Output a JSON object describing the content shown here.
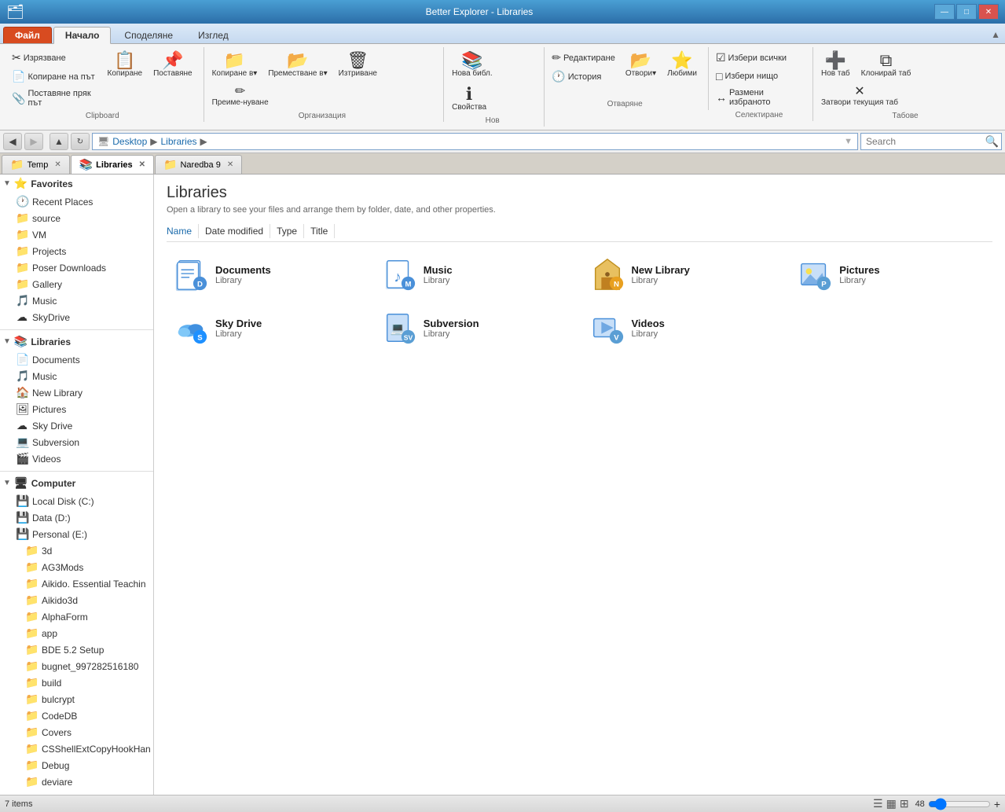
{
  "window": {
    "title": "Better Explorer - Libraries",
    "controls": [
      "—",
      "□",
      "✕"
    ]
  },
  "ribbon": {
    "tabs": [
      "Файл",
      "Начало",
      "Споделяне",
      "Изглед"
    ],
    "active_tab": "Начало",
    "groups": [
      {
        "label": "Clipboard",
        "buttons": [
          {
            "id": "copy",
            "label": "Копиране",
            "icon": "📋"
          },
          {
            "id": "paste",
            "label": "Поставяне",
            "icon": "📌"
          }
        ],
        "small_buttons": [
          {
            "label": "Изрязване",
            "icon": "✂"
          },
          {
            "label": "Копиране на път",
            "icon": "📄"
          },
          {
            "label": "Поставяне пряк път",
            "icon": "📎"
          }
        ]
      },
      {
        "label": "Организация",
        "buttons": [
          {
            "id": "copy-to",
            "label": "Копиране в▾",
            "icon": "📁"
          },
          {
            "id": "move-to",
            "label": "Преместване в▾",
            "icon": "📂"
          },
          {
            "id": "delete",
            "label": "Изтриване",
            "icon": "🗑"
          },
          {
            "id": "rename",
            "label": "Преиме-нуване",
            "icon": "✏"
          }
        ]
      },
      {
        "label": "Нов",
        "buttons": [
          {
            "id": "new-folder",
            "label": "Нова библ.",
            "icon": "📚"
          },
          {
            "id": "properties",
            "label": "Свойства",
            "icon": "ℹ"
          }
        ]
      },
      {
        "label": "Отваряне",
        "buttons": [
          {
            "id": "open",
            "label": "Отвори▾",
            "icon": "📂"
          },
          {
            "id": "favorites",
            "label": "Любими",
            "icon": "⭐"
          }
        ],
        "small_buttons2": [
          {
            "label": "Редактиране",
            "icon": "✏"
          },
          {
            "label": "История",
            "icon": "🕐"
          }
        ]
      },
      {
        "label": "Селектиране",
        "buttons": [
          {
            "id": "select-all",
            "label": "Избери всички",
            "icon": "☑"
          },
          {
            "id": "select-none",
            "label": "Избери нищо",
            "icon": "□"
          },
          {
            "id": "invert",
            "label": "Размени избраното",
            "icon": "↔"
          }
        ]
      },
      {
        "label": "Табове",
        "buttons": [
          {
            "id": "new-tab",
            "label": "Нов таб",
            "icon": "➕"
          },
          {
            "id": "clone-tab",
            "label": "Клонирай таб",
            "icon": "⧉"
          },
          {
            "id": "close-tab",
            "label": "Затвори текущия таб",
            "icon": "✕"
          }
        ]
      }
    ]
  },
  "addressbar": {
    "back": "◀",
    "forward": "▶",
    "up": "▲",
    "breadcrumbs": [
      "Desktop",
      "Libraries"
    ],
    "search_placeholder": "Search"
  },
  "tabs": [
    {
      "label": "Temp",
      "icon": "📁",
      "closable": true
    },
    {
      "label": "Libraries",
      "icon": "📚",
      "closable": true,
      "active": true
    },
    {
      "label": "Naredba 9",
      "icon": "📁",
      "closable": true
    }
  ],
  "sidebar": {
    "favorites": {
      "label": "Recent Places",
      "items": [
        {
          "label": "Recent Places",
          "icon": "🕐"
        },
        {
          "label": "source",
          "icon": "📁"
        },
        {
          "label": "VM",
          "icon": "📁"
        },
        {
          "label": "Projects",
          "icon": "📁"
        },
        {
          "label": "Poser Downloads",
          "icon": "📁"
        },
        {
          "label": "Gallery",
          "icon": "📁"
        },
        {
          "label": "Music",
          "icon": "🎵"
        },
        {
          "label": "SkyDrive",
          "icon": "☁"
        }
      ]
    },
    "libraries": {
      "label": "Libraries",
      "items": [
        {
          "label": "Documents",
          "icon": "📄"
        },
        {
          "label": "Music",
          "icon": "🎵"
        },
        {
          "label": "New Library",
          "icon": "🏠"
        },
        {
          "label": "Pictures",
          "icon": "🖼"
        },
        {
          "label": "Sky Drive",
          "icon": "☁"
        },
        {
          "label": "Subversion",
          "icon": "💻"
        },
        {
          "label": "Videos",
          "icon": "🎬"
        }
      ]
    },
    "computer": {
      "label": "Computer",
      "drives": [
        {
          "label": "Local Disk (C:)",
          "icon": "💾"
        },
        {
          "label": "Data (D:)",
          "icon": "💾"
        },
        {
          "label": "Personal (E:)",
          "icon": "💾"
        }
      ],
      "folders": [
        "3d",
        "AG3Mods",
        "Aikido. Essential Teachin",
        "Aikido3d",
        "AlphaForm",
        "app",
        "BDE 5.2 Setup",
        "bugnet_997282516180",
        "build",
        "bulcrypt",
        "CodeDB",
        "Covers",
        "CSShellExtCopyHookHan",
        "Debug",
        "deviare"
      ]
    }
  },
  "content": {
    "title": "Libraries",
    "description": "Open a library to see your files and arrange them by folder, date, and other properties.",
    "columns": [
      "Name",
      "Date modified",
      "Type",
      "Title"
    ],
    "libraries": [
      {
        "name": "Documents",
        "type": "Library",
        "icon": "docs"
      },
      {
        "name": "Music",
        "type": "Library",
        "icon": "music"
      },
      {
        "name": "New Library",
        "type": "Library",
        "icon": "newlib"
      },
      {
        "name": "Pictures",
        "type": "Library",
        "icon": "pictures"
      },
      {
        "name": "Sky Drive",
        "type": "Library",
        "icon": "skydrive"
      },
      {
        "name": "Subversion",
        "type": "Library",
        "icon": "subversion"
      },
      {
        "name": "Videos",
        "type": "Library",
        "icon": "videos"
      }
    ]
  },
  "statusbar": {
    "items_count": "7 items",
    "zoom": "48"
  }
}
